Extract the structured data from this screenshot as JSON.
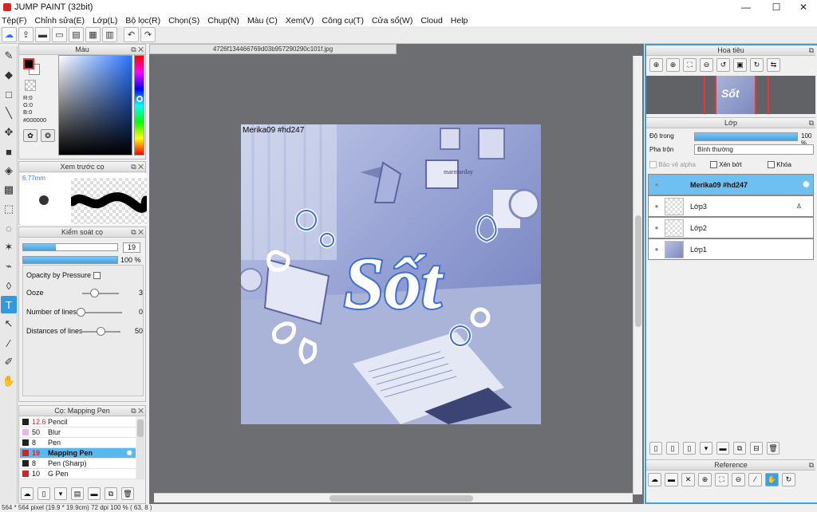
{
  "window": {
    "title": "JUMP PAINT (32bit)",
    "minimize": "—",
    "maximize": "☐",
    "close": "✕"
  },
  "menu": [
    "Tệp(F)",
    "Chỉnh sửa(E)",
    "Lớp(L)",
    "Bộ lọc(R)",
    "Chọn(S)",
    "Chụp(N)",
    "Màu (C)",
    "Xem(V)",
    "Công cụ(T)",
    "Cửa sổ(W)",
    "Cloud",
    "Help"
  ],
  "color_panel": {
    "title": "Màu",
    "r": "R:0",
    "g": "G:0",
    "b": "B:0",
    "hex": "#000000",
    "accent": "#2a74ff"
  },
  "brush_preview": {
    "title": "Xem trước cọ",
    "size": "6.77mm"
  },
  "brush_control": {
    "title": "Kiểm soát cọ",
    "size_value": "19",
    "size_level": 0.35,
    "opacity_value": "100 %",
    "opacity_level": 1.0,
    "opacity_by_pressure": "Opacity by Pressure",
    "ooze_label": "Ooze",
    "ooze_value": "3",
    "lines_label": "Number of lines",
    "lines_value": "0",
    "distances_label": "Distances of lines",
    "distances_value": "50"
  },
  "brush_list": {
    "title": "Cọ: Mapping Pen",
    "items": [
      {
        "size": "12.6",
        "name": "Pencil",
        "color": "#222222"
      },
      {
        "size": "50",
        "name": "Blur",
        "color": "#f0b4e6"
      },
      {
        "size": "8",
        "name": "Pen",
        "color": "#222222"
      },
      {
        "size": "19",
        "name": "Mapping Pen",
        "color": "#d22222"
      },
      {
        "size": "8",
        "name": "Pen (Sharp)",
        "color": "#222222"
      },
      {
        "size": "10",
        "name": "G Pen",
        "color": "#d22222"
      }
    ]
  },
  "document": {
    "tab": "4726f134466769d03b957290290c101f.jpg",
    "watermark": "Merika09  #hd247",
    "art_title": "Sốt",
    "sign": "marmurday"
  },
  "navigator": {
    "title": "Hoa tiêu",
    "mini_text": "Sốt"
  },
  "layers": {
    "title": "Lớp",
    "opacity_label": "Độ trong",
    "opacity_value": "100 %",
    "opacity_level": 1.0,
    "blend_label": "Pha trộn",
    "blend_value": "Bình thường",
    "protect_alpha": "Bảo vệ alpha",
    "clip": "Xén bớt",
    "lock": "Khóa",
    "items": [
      {
        "name": "Merika09  #hd247"
      },
      {
        "name": "Lớp3"
      },
      {
        "name": "Lớp2"
      },
      {
        "name": "Lớp1"
      }
    ]
  },
  "reference": {
    "title": "Reference"
  },
  "status": {
    "text": "564 * 564 pixel   (19.9 * 19.9cm)   72 dpi   100 %   ( 63, 8 )"
  }
}
